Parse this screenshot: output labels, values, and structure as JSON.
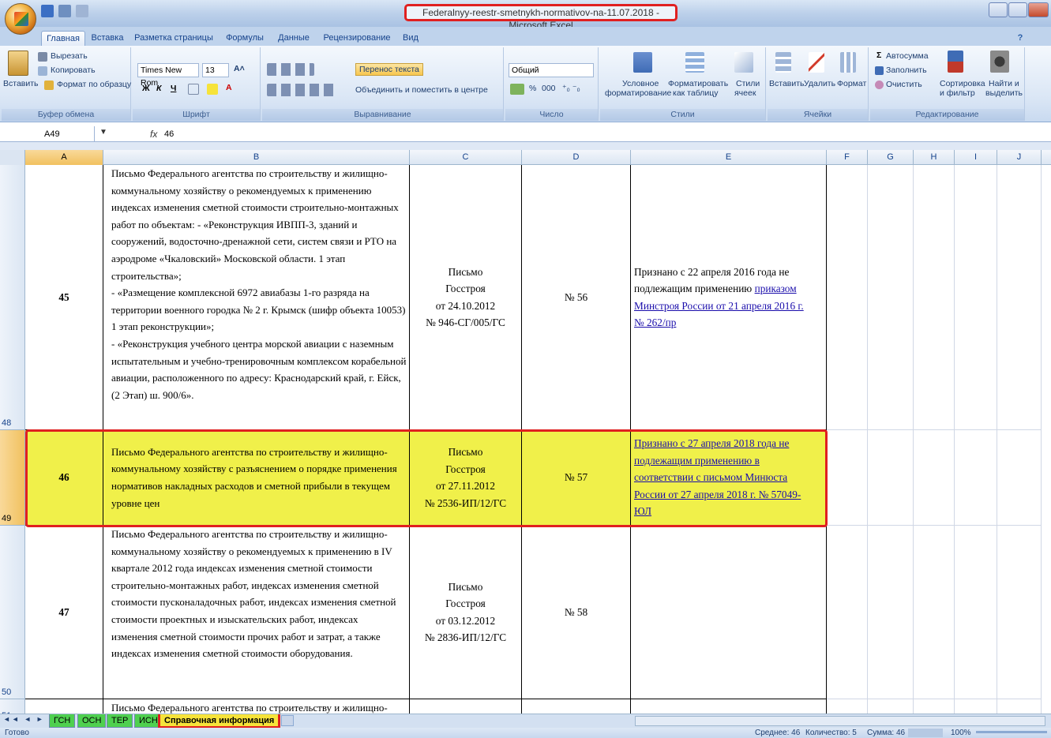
{
  "window": {
    "title": "Federalnyy-reestr-smetnykh-normativov-na-11.07.2018 - Microsoft Excel"
  },
  "ribbon_tabs": [
    "Главная",
    "Вставка",
    "Разметка страницы",
    "Формулы",
    "Данные",
    "Рецензирование",
    "Вид"
  ],
  "clipboard": {
    "paste": "Вставить",
    "cut": "Вырезать",
    "copy": "Копировать",
    "format_painter": "Формат по образцу",
    "label": "Буфер обмена"
  },
  "font": {
    "name": "Times New Rom",
    "size": "13",
    "label": "Шрифт",
    "bold": "Ж",
    "italic": "К",
    "underline": "Ч"
  },
  "alignment": {
    "wrap": "Перенос текста",
    "merge": "Объединить и поместить в центре",
    "label": "Выравнивание"
  },
  "number": {
    "format": "Общий",
    "label": "Число",
    "percent": "%",
    "thousands": "000"
  },
  "styles": {
    "conditional_1": "Условное",
    "conditional_2": "форматирование",
    "table_1": "Форматировать",
    "table_2": "как таблицу",
    "cell_1": "Стили",
    "cell_2": "ячеек",
    "label": "Стили"
  },
  "cells": {
    "insert": "Вставить",
    "delete": "Удалить",
    "format": "Формат",
    "label": "Ячейки"
  },
  "editing": {
    "autosum": "Автосумма",
    "fill": "Заполнить",
    "clear": "Очистить",
    "sort_1": "Сортировка",
    "sort_2": "и фильтр",
    "find_1": "Найти и",
    "find_2": "выделить",
    "label": "Редактирование"
  },
  "formula_bar": {
    "name_box": "A49",
    "fx": "fx",
    "value": "46"
  },
  "columns": [
    "A",
    "B",
    "C",
    "D",
    "E",
    "F",
    "G",
    "H",
    "I",
    "J"
  ],
  "rows": [
    {
      "row_num": "48",
      "a": "45",
      "b": "Письмо Федерального агентства по строительству и жилищно-коммунальному хозяйству о рекомендуемых к применению индексах изменения сметной стоимости строительно-монтажных работ по объектам: - «Реконструкция ИВПП-3, зданий и сооружений, водосточно-дренажной сети, систем связи и РТО на аэродроме «Чкаловский» Московской области. 1 этап строительства»;\n- «Размещение комплексной 6972 авиабазы 1-го разряда на территории военного городка № 2 г. Крымск (шифр объекта 10053) 1 этап реконструкции»;\n- «Реконструкция учебного центра морской авиации с наземным испытательным и учебно-тренировочным комплексом корабельной авиации, расположенного по адресу: Краснодарский край, г. Ейск, (2 Этап) ш. 900/6».",
      "c": [
        "Письмо",
        "Госстроя",
        "от 24.10.2012",
        "№ 946-СГ/005/ГС"
      ],
      "d": "№ 56",
      "e_text": "Признано с 22 апреля 2016 года не подлежащим применению ",
      "e_link": "приказом Минстроя России от 21 апреля 2016 г. № 262/пр"
    },
    {
      "row_num": "49",
      "a": "46",
      "b": "Письмо Федерального агентства по строительству и жилищно-коммунальному хозяйству с разъяснением о порядке применения нормативов накладных расходов и сметной прибыли в текущем уровне цен",
      "c": [
        "Письмо",
        "Госстроя",
        "от 27.11.2012",
        "№ 2536-ИП/12/ГС"
      ],
      "d": "№ 57",
      "e_text": "",
      "e_link": "Признано с 27 апреля 2018 года не подлежащим применению в соответствии с письмом Минюста России от 27 апреля 2018 г. № 57049-ЮЛ"
    },
    {
      "row_num": "50",
      "a": "47",
      "b": "Письмо Федерального агентства по строительству и жилищно-коммунальному хозяйству о рекомендуемых к применению в IV квартале 2012 года индексах изменения сметной стоимости строительно-монтажных работ, индексах изменения сметной стоимости пусконаладочных работ, индексах изменения сметной стоимости проектных и изыскательских работ, индексах изменения сметной стоимости прочих работ и затрат, а также индексах изменения сметной стоимости оборудования.",
      "c": [
        "Письмо",
        "Госстроя",
        "от 03.12.2012",
        "№ 2836-ИП/12/ГС"
      ],
      "d": "№ 58",
      "e_text": "",
      "e_link": ""
    },
    {
      "row_num": "51",
      "a": "",
      "b": "Письмо Федерального агентства по строительству и жилищно-",
      "c": [],
      "d": "",
      "e_text": "",
      "e_link": ""
    }
  ],
  "sheets": [
    "ГСН",
    "ОСН",
    "ТЕР",
    "ИСН",
    "Справочная информация"
  ],
  "status": {
    "ready": "Готово",
    "average": "Среднее: 46",
    "count": "Количество: 5",
    "sum": "Сумма: 46",
    "zoom": "100%"
  }
}
